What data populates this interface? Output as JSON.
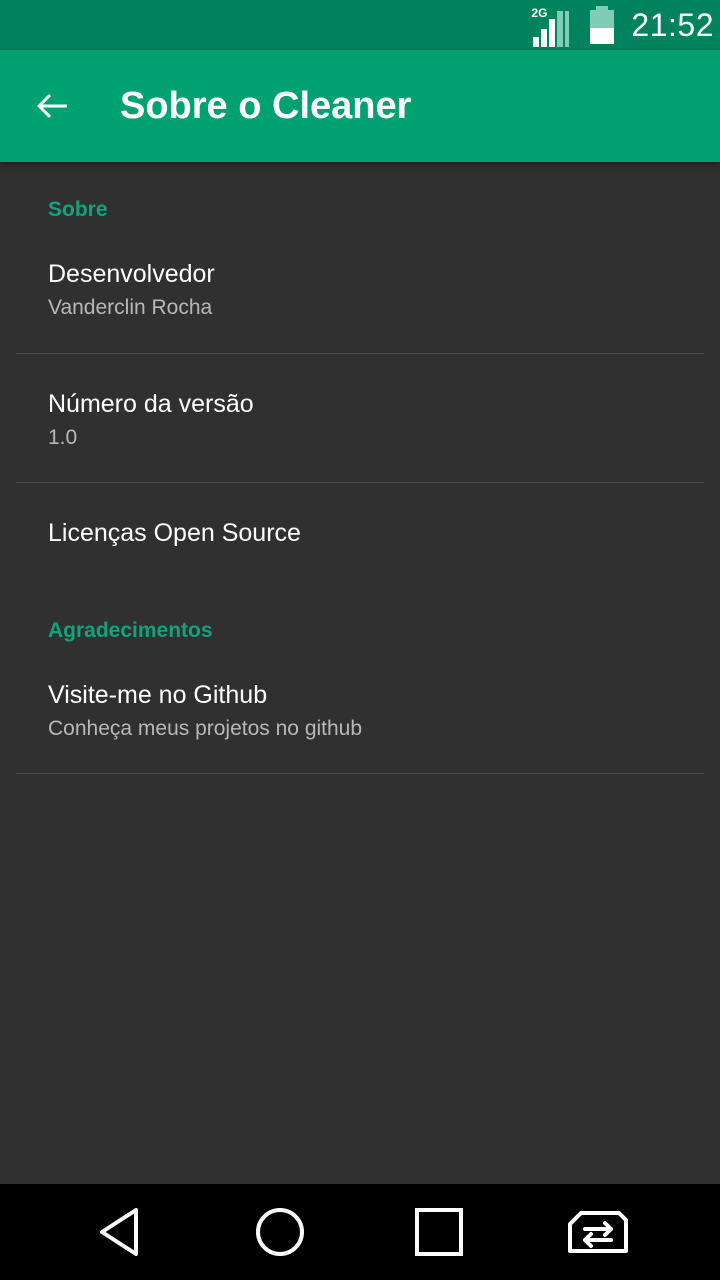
{
  "status_bar": {
    "network_type": "2G",
    "time": "21:52",
    "icons": [
      "signal-icon",
      "battery-icon"
    ]
  },
  "app_bar": {
    "title": "Sobre o Cleaner",
    "back_icon": "arrow-back-icon"
  },
  "sections": [
    {
      "header": "Sobre",
      "items": [
        {
          "title": "Desenvolvedor",
          "summary": "Vanderclin Rocha"
        },
        {
          "title": "Número da versão",
          "summary": "1.0"
        },
        {
          "title": "Licenças Open Source",
          "summary": ""
        }
      ]
    },
    {
      "header": "Agradecimentos",
      "items": [
        {
          "title": "Visite-me no Github",
          "summary": "Conheça meus projetos no github"
        }
      ]
    }
  ],
  "nav_bar": {
    "icons": [
      "back-triangle-icon",
      "home-circle-icon",
      "recents-square-icon",
      "sim-switch-icon"
    ]
  },
  "colors": {
    "status_bar": "#00835d",
    "app_bar": "#00a171",
    "accent": "#12a37a",
    "background": "#303030"
  }
}
